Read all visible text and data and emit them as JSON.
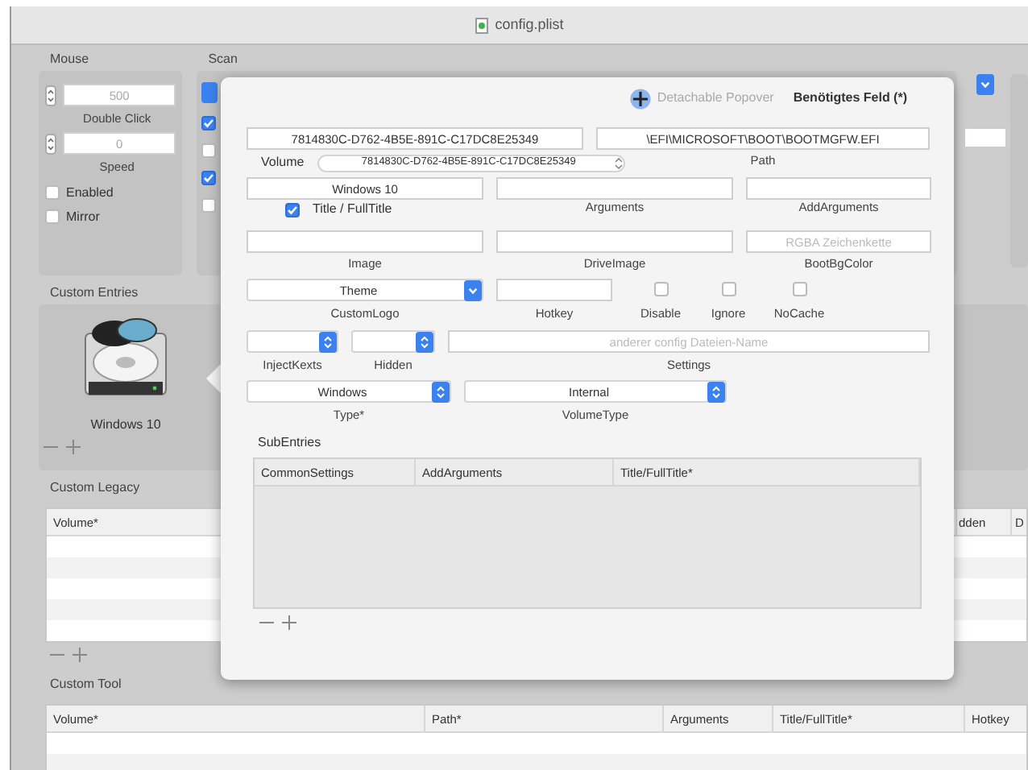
{
  "window": {
    "title": "config.plist"
  },
  "mouse": {
    "label": "Mouse",
    "steppers": [
      {
        "value": "500",
        "label": "Double Click"
      },
      {
        "value": "0",
        "label": "Speed"
      }
    ],
    "options": [
      {
        "label": "Enabled",
        "checked": false
      },
      {
        "label": "Mirror",
        "checked": false
      }
    ]
  },
  "scan": {
    "label": "Scan",
    "options": [
      {
        "checked": true
      },
      {
        "checked": false
      },
      {
        "checked": true
      },
      {
        "checked": false
      }
    ]
  },
  "custom_entries": {
    "label": "Custom Entries",
    "entries": [
      {
        "title": "Windows 10"
      }
    ]
  },
  "custom_legacy": {
    "label": "Custom Legacy",
    "columns": [
      "Volume*",
      "dden",
      "D"
    ]
  },
  "custom_tool": {
    "label": "Custom Tool",
    "columns": [
      "Volume*",
      "Path*",
      "Arguments",
      "Title/FullTitle*",
      "Hotkey"
    ]
  },
  "popover": {
    "detach_label": "Detachable Popover",
    "required_note": "Benötigtes Feld (*)",
    "volume_uuid": "7814830C-D762-4B5E-891C-C17DC8E25349",
    "path": "\\EFI\\MICROSOFT\\BOOT\\BOOTMGFW.EFI",
    "volume_label": "Volume",
    "volume_popup": "7814830C-D762-4B5E-891C-C17DC8E25349",
    "path_label": "Path",
    "title": "Windows 10",
    "title_label": "Title / FullTitle",
    "title_checked": true,
    "arguments_label": "Arguments",
    "add_arguments_label": "AddArguments",
    "image_label": "Image",
    "drive_image_label": "DriveImage",
    "boot_bg_color_placeholder": "RGBA Zeichenkette",
    "boot_bg_color_label": "BootBgColor",
    "custom_logo": "Theme",
    "custom_logo_label": "CustomLogo",
    "hotkey_label": "Hotkey",
    "flags": [
      {
        "label": "Disable",
        "checked": false
      },
      {
        "label": "Ignore",
        "checked": false
      },
      {
        "label": "NoCache",
        "checked": false
      }
    ],
    "inject_kexts_label": "InjectKexts",
    "hidden_label": "Hidden",
    "settings_placeholder": "anderer config Dateien-Name",
    "settings_label": "Settings",
    "type": "Windows",
    "type_label": "Type*",
    "volume_type": "Internal",
    "volume_type_label": "VolumeType",
    "subentries": {
      "label": "SubEntries",
      "columns": [
        "CommonSettings",
        "AddArguments",
        "Title/FullTitle*"
      ]
    }
  }
}
